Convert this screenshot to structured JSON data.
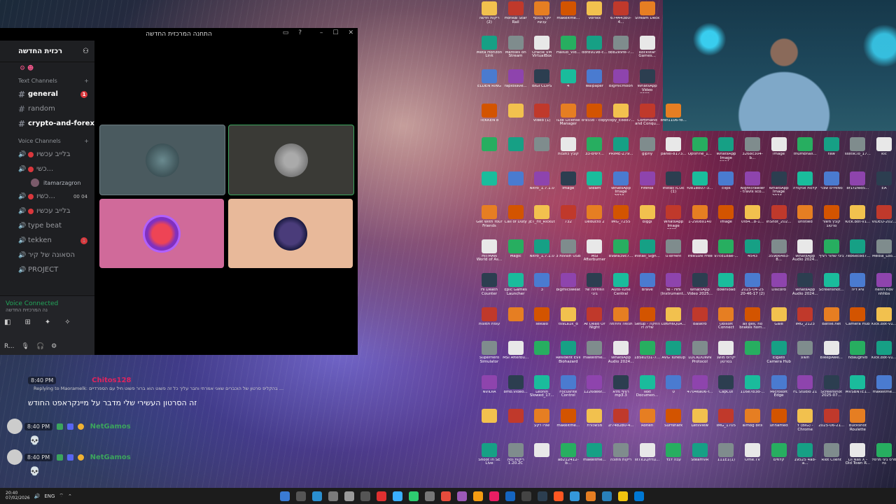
{
  "discord": {
    "window_title": "התחנה המרכזית החדשה",
    "server_name": "רכזית החדשה",
    "text_channels_label": "Text Channels",
    "voice_channels_label": "Voice Channels",
    "text_channels": [
      {
        "name": "general",
        "badge": "1"
      },
      {
        "name": "random",
        "badge": ""
      },
      {
        "name": "crypto-and-forex",
        "badge": ""
      }
    ],
    "voice_channels": [
      {
        "name": "בלייב עכשיו",
        "badge": ""
      },
      {
        "name": "כשי...",
        "badge": ""
      },
      {
        "name": "כשיו...",
        "badge": ""
      },
      {
        "name": "בלייב עכשיו",
        "badge": ""
      },
      {
        "name": "type beat",
        "badge": ""
      },
      {
        "name": "tekken",
        "badge": "1"
      },
      {
        "name": "הסאונה של קיר",
        "badge": ""
      },
      {
        "name": "PROJECT",
        "badge": ""
      }
    ],
    "member_name": "itamarzagron",
    "count_a": "00",
    "count_b": "04",
    "voice_connected": "Voice Connected",
    "voice_sub": "נה המרכזית החדשה",
    "user_short": "R..."
  },
  "chat": {
    "messages": [
      {
        "time": "8:40 PM",
        "user": "Chitos128",
        "reply": "Replying to Maoramelk: בהקליפ סרטון של הוכברים שאני אמרתי וחבר עליך כל זה פשוט הוא ברור פשוט חיל עם הספרדיים ...",
        "text": "זה הסרטון העשירי שלי מדבר על מיינקראפט החודש"
      },
      {
        "time": "8:40 PM",
        "user": "NetGamos",
        "text": "💀"
      },
      {
        "time": "8:40 PM",
        "user": "NetGamos",
        "text": "💀"
      }
    ]
  },
  "desktop_icons": [
    [
      "ריקות חדשה (2)",
      "Honkai Star Rail",
      "יוקר בנוסף עכשיו",
      "makeitme...",
      "Vortex",
      "674443b0-4...",
      "Stream Deck"
    ],
    [
      "Meta Horizon Link",
      "Marbles on Stream",
      "Oracle VM VirtualBox",
      "Hailuo_Vid...",
      "d8f89198-c...",
      "dbb2e9fe-7...",
      "Rockstar Games..."
    ],
    [
      "ELDEN RING",
      "rapidsave...",
      "BIGI CLIPS",
      "4",
      "walpaper",
      "Bigmicmoon",
      "WhatsApp Video 2025-..."
    ],
    [
      "TEKKEN 8",
      "",
      "video (1)",
      "iLok License Manager",
      "סבבונים - copy",
      "copy_E8887...",
      "Command and Conqu...",
      "8fef1106-f8..."
    ],
    [
      "",
      "",
      "",
      "קובץ כתובות",
      "ליסים-33...",
      "PRIME-Z79...",
      "giphy",
      "panel-8173...",
      "OptiFine_1...",
      "WhatsApp Image 2024...",
      "3268c304-b...",
      "image",
      "thumbnail...",
      "raw",
      "ssstik.io_17...",
      "kic",
      "Untitled_..."
    ],
    [
      "",
      "",
      "Nitro_1.7.1.0",
      "image",
      "Steam",
      "WhatsApp Image 2024...",
      "Firefox",
      "Install iCUE (1)",
      "f081eb07-3...",
      "clips",
      "Nightcrawler - travis sco...",
      "WhatsApp Image 2024...",
      "קלטת אנקנדה",
      "סמפלים שוכר",
      "8f1f1fed5...",
      "EA",
      "Media_Loo..."
    ],
    [
      "Get With Your Friends",
      "Call of Duty",
      "JET_Fit_Rickutto_p...",
      "732",
      "Deducto 2",
      "IMG_7255",
      "biggi",
      "WhatsApp Image 2025...",
      "1-2908x140",
      "image",
      "0f84...8-1...",
      "InShot_202...",
      "untitled",
      "קובץ משור סרטוב",
      "Kick.bot-v1...",
      "VIDEO-202..."
    ],
    [
      "HITMAN World of As...",
      "Magic",
      "Nitro_1.7.1.0",
      "תוצאות 3 USB",
      "MSI Afterburner",
      "b9afa39c7...",
      "Install_Sign...",
      "uTorrent",
      "TreeSize Free",
      "97cd18ae-...",
      "4543",
      "359b6483-8...",
      "WhatsApp Audio 2024...",
      "ביבי שחור רציף",
      "7eb6ec8d7...",
      "Media_Loo..."
    ],
    [
      "Hi Death Counter",
      "Epic Games Launcher",
      "3",
      "bigmicsweat",
      "הפתיחה של ביבי",
      "Auto-Tune Central",
      "Brave",
      "Ye - HHI (Instrument...",
      "WhatsApp Video 2025...",
      "download",
      "2025-04-25 20-46-17 (2)",
      "Discord",
      "WhatsApp Audio 2024...",
      "Screenshot...",
      "ציא דיה",
      "henri ndv nhhbs"
    ],
    [
      "עוסת תמונות",
      "",
      "sekaio",
      "ts9La1k_d",
      "At Dead Or Night",
      "תנופה וחולמה",
      "Setup - הזזקה שליה דו",
      "Dz6H6QuA...",
      "Balatro",
      "Ubisoft Connect",
      "all ges, no brakes hom...",
      "Gale",
      "IMG_2123",
      "Battle.net",
      "Camera Hub",
      "Kick.bot-v1...",
      "Getting Over It with Ben..."
    ],
    [
      "Superhero Simulator",
      "MSI Afterbu...",
      "",
      "Resident Evil Biohazard",
      "makeitme...",
      "WhatsApp Audio 2024...",
      "1b5e1f31-7...",
      "AVG TuneUp",
      "LOCKDOWN Protocol",
      "יקרוס מושג בסרטון",
      "",
      "Elgato Camera Hub",
      "חשוונ",
      "BleepAwe...",
      "hdaughvd",
      "Kick.bot-v1..."
    ],
    [
      "NVIDIA",
      "8mb.video...",
      "Leonin Slowed_17...",
      "Focusrite Control",
      "1226de6f...",
      "רציף מלא mp3.3",
      "Text Documen...",
      "0",
      "47046a06-f...",
      "CapCut",
      "116e7b3d-...",
      "Microsoft Edge",
      "FL Studio 21",
      "Screenshot 2025-07...",
      "MVSBNTE1...",
      "makeitme..."
    ],
    [
      "",
      "",
      "שורו רקע",
      "makeitme...",
      "מבשכורת",
      "1f74b2b0-4...",
      "Ronen",
      "Surfshark",
      "LetsView",
      "IMG_1705",
      "almog bits",
      "unnamed",
      "Y (BIG) - Chrome",
      "2025-06-21...",
      "Buckshot Roulette"
    ],
    [
      "Shoot In SE Live",
      "ריקות נסה 1.20.2C",
      "",
      "ab212412-b...",
      "makeitme...",
      "ריקות מתוכה",
      "stTx1QFrtu...",
      "עבה לבד",
      "SteamVR",
      "111E1(1)",
      "Ome.TV",
      "קלפים",
      "19525 4a8-a...",
      "Riot Client",
      "Lil Nas X - Old Town R...",
      "מרס ביגי מרסל נח"
    ]
  ],
  "taskbar": {
    "time": "20:40",
    "date": "07/02/2026",
    "lang": "ENG"
  }
}
